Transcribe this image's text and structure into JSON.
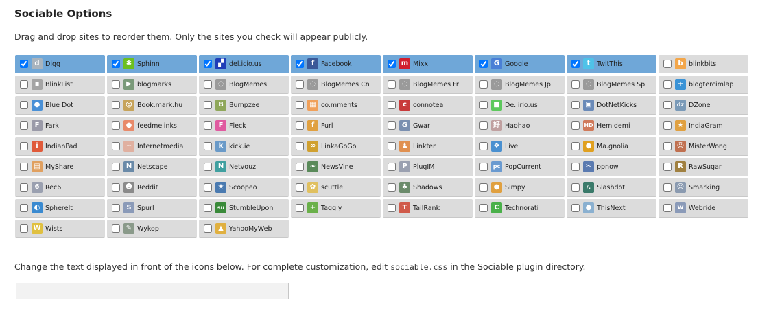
{
  "heading": "Sociable Options",
  "intro": "Drag and drop sites to reorder them. Only the sites you check will appear publicly.",
  "help": {
    "before": "Change the text displayed in front of the icons below. For complete customization, edit ",
    "code": "sociable.css",
    "after": " in the Sociable plugin directory."
  },
  "tagline": {
    "value": "",
    "placeholder": ""
  },
  "colors": {
    "checked_bg": "#6fa7d8",
    "unchecked_bg": "#dcdcdc"
  },
  "sites": [
    {
      "name": "Digg",
      "checked": true,
      "icon": "digg-icon",
      "glyph": "d",
      "color": "#a9b4be"
    },
    {
      "name": "Sphinn",
      "checked": true,
      "icon": "sphinn-icon",
      "glyph": "✱",
      "color": "#6cbf1f"
    },
    {
      "name": "del.icio.us",
      "checked": true,
      "icon": "delicious-icon",
      "glyph": "▞",
      "color": "#1f3db8"
    },
    {
      "name": "Facebook",
      "checked": true,
      "icon": "facebook-icon",
      "glyph": "f",
      "color": "#3b5998"
    },
    {
      "name": "Mixx",
      "checked": true,
      "icon": "mixx-icon",
      "glyph": "m",
      "color": "#d11f2e"
    },
    {
      "name": "Google",
      "checked": true,
      "icon": "google-icon",
      "glyph": "G",
      "color": "#4a7fd6"
    },
    {
      "name": "TwitThis",
      "checked": true,
      "icon": "twitthis-icon",
      "glyph": "t",
      "color": "#4fc2e8"
    },
    {
      "name": "blinkbits",
      "checked": false,
      "icon": "blinkbits-icon",
      "glyph": "b",
      "color": "#f3a64a"
    },
    {
      "name": "BlinkList",
      "checked": false,
      "icon": "blinklist-icon",
      "glyph": "▪",
      "color": "#a4a4a4"
    },
    {
      "name": "blogmarks",
      "checked": false,
      "icon": "blogmarks-icon",
      "glyph": "▶",
      "color": "#7a9a7a"
    },
    {
      "name": "BlogMemes",
      "checked": false,
      "icon": "blogmemes-icon",
      "glyph": "◌",
      "color": "#9a9a9a"
    },
    {
      "name": "BlogMemes Cn",
      "checked": false,
      "icon": "blogmemes-cn-icon",
      "glyph": "◌",
      "color": "#9a9a9a"
    },
    {
      "name": "BlogMemes Fr",
      "checked": false,
      "icon": "blogmemes-fr-icon",
      "glyph": "◌",
      "color": "#9a9a9a"
    },
    {
      "name": "BlogMemes Jp",
      "checked": false,
      "icon": "blogmemes-jp-icon",
      "glyph": "◌",
      "color": "#9a9a9a"
    },
    {
      "name": "BlogMemes Sp",
      "checked": false,
      "icon": "blogmemes-sp-icon",
      "glyph": "◌",
      "color": "#9a9a9a"
    },
    {
      "name": "blogtercimlap",
      "checked": false,
      "icon": "blogtercimlap-icon",
      "glyph": "+",
      "color": "#3b93d6"
    },
    {
      "name": "Blue Dot",
      "checked": false,
      "icon": "blue-dot-icon",
      "glyph": "●",
      "color": "#4a90d6"
    },
    {
      "name": "Book.mark.hu",
      "checked": false,
      "icon": "bookmark-hu-icon",
      "glyph": "@",
      "color": "#c6a35a"
    },
    {
      "name": "Bumpzee",
      "checked": false,
      "icon": "bumpzee-icon",
      "glyph": "B",
      "color": "#8fa75a"
    },
    {
      "name": "co.mments",
      "checked": false,
      "icon": "comments-icon",
      "glyph": "▦",
      "color": "#f0a05a"
    },
    {
      "name": "connotea",
      "checked": false,
      "icon": "connotea-icon",
      "glyph": "c",
      "color": "#c83a3a"
    },
    {
      "name": "De.lirio.us",
      "checked": false,
      "icon": "delirious-icon",
      "glyph": "■",
      "color": "#5dc85d"
    },
    {
      "name": "DotNetKicks",
      "checked": false,
      "icon": "dotnetkicks-icon",
      "glyph": "▣",
      "color": "#6a8ab8"
    },
    {
      "name": "DZone",
      "checked": false,
      "icon": "dzone-icon",
      "glyph": "dz",
      "color": "#7a9ab8"
    },
    {
      "name": "Fark",
      "checked": false,
      "icon": "fark-icon",
      "glyph": "F",
      "color": "#9a9aa8"
    },
    {
      "name": "feedmelinks",
      "checked": false,
      "icon": "feedmelinks-icon",
      "glyph": "●",
      "color": "#e88a6a"
    },
    {
      "name": "Fleck",
      "checked": false,
      "icon": "fleck-icon",
      "glyph": "F",
      "color": "#e05aa0"
    },
    {
      "name": "Furl",
      "checked": false,
      "icon": "furl-icon",
      "glyph": "f",
      "color": "#e0a040"
    },
    {
      "name": "Gwar",
      "checked": false,
      "icon": "gwar-icon",
      "glyph": "G",
      "color": "#7a8fb0"
    },
    {
      "name": "Haohao",
      "checked": false,
      "icon": "haohao-icon",
      "glyph": "好",
      "color": "#c0a0a0"
    },
    {
      "name": "Hemidemi",
      "checked": false,
      "icon": "hemidemi-icon",
      "glyph": "HD",
      "color": "#d07a5a"
    },
    {
      "name": "IndiaGram",
      "checked": false,
      "icon": "indiagram-icon",
      "glyph": "★",
      "color": "#e0a040"
    },
    {
      "name": "IndianPad",
      "checked": false,
      "icon": "indianpad-icon",
      "glyph": "i",
      "color": "#e05a3a"
    },
    {
      "name": "Internetmedia",
      "checked": false,
      "icon": "internetmedia-icon",
      "glyph": "~",
      "color": "#e0b0a0"
    },
    {
      "name": "kick.ie",
      "checked": false,
      "icon": "kickie-icon",
      "glyph": "k",
      "color": "#6a9ac8"
    },
    {
      "name": "LinkaGoGo",
      "checked": false,
      "icon": "linkagogo-icon",
      "glyph": "∞",
      "color": "#d0a030"
    },
    {
      "name": "Linkter",
      "checked": false,
      "icon": "linkter-icon",
      "glyph": "♟",
      "color": "#e09050"
    },
    {
      "name": "Live",
      "checked": false,
      "icon": "live-icon",
      "glyph": "❖",
      "color": "#4a90d0"
    },
    {
      "name": "Ma.gnolia",
      "checked": false,
      "icon": "magnolia-icon",
      "glyph": "●",
      "color": "#e0a020"
    },
    {
      "name": "MisterWong",
      "checked": false,
      "icon": "misterwong-icon",
      "glyph": "☺",
      "color": "#c07050"
    },
    {
      "name": "MyShare",
      "checked": false,
      "icon": "myshare-icon",
      "glyph": "▤",
      "color": "#e0a060"
    },
    {
      "name": "Netscape",
      "checked": false,
      "icon": "netscape-icon",
      "glyph": "N",
      "color": "#6a8aa8"
    },
    {
      "name": "Netvouz",
      "checked": false,
      "icon": "netvouz-icon",
      "glyph": "N",
      "color": "#40a0a0"
    },
    {
      "name": "NewsVine",
      "checked": false,
      "icon": "newsvine-icon",
      "glyph": "❧",
      "color": "#5a8a5a"
    },
    {
      "name": "PlugIM",
      "checked": false,
      "icon": "plugim-icon",
      "glyph": "P",
      "color": "#9aa0b0"
    },
    {
      "name": "PopCurrent",
      "checked": false,
      "icon": "popcurrent-icon",
      "glyph": "pc",
      "color": "#6a9ad0"
    },
    {
      "name": "ppnow",
      "checked": false,
      "icon": "ppnow-icon",
      "glyph": "✂",
      "color": "#5a7ab0"
    },
    {
      "name": "RawSugar",
      "checked": false,
      "icon": "rawsugar-icon",
      "glyph": "R",
      "color": "#a08040"
    },
    {
      "name": "Rec6",
      "checked": false,
      "icon": "rec6-icon",
      "glyph": "6",
      "color": "#9aa0b0"
    },
    {
      "name": "Reddit",
      "checked": false,
      "icon": "reddit-icon",
      "glyph": "☻",
      "color": "#8a8a8a"
    },
    {
      "name": "Scoopeo",
      "checked": false,
      "icon": "scoopeo-icon",
      "glyph": "★",
      "color": "#4a7ab0"
    },
    {
      "name": "scuttle",
      "checked": false,
      "icon": "scuttle-icon",
      "glyph": "✿",
      "color": "#e0c060"
    },
    {
      "name": "Shadows",
      "checked": false,
      "icon": "shadows-icon",
      "glyph": "♣",
      "color": "#6a8a6a"
    },
    {
      "name": "Simpy",
      "checked": false,
      "icon": "simpy-icon",
      "glyph": "●",
      "color": "#e0a040"
    },
    {
      "name": "Slashdot",
      "checked": false,
      "icon": "slashdot-icon",
      "glyph": "/.",
      "color": "#3a7a6a"
    },
    {
      "name": "Smarking",
      "checked": false,
      "icon": "smarking-icon",
      "glyph": "☺",
      "color": "#8a9ab0"
    },
    {
      "name": "SphereIt",
      "checked": false,
      "icon": "sphereit-icon",
      "glyph": "◐",
      "color": "#3a8ad0"
    },
    {
      "name": "Spurl",
      "checked": false,
      "icon": "spurl-icon",
      "glyph": "S",
      "color": "#8a9ab8"
    },
    {
      "name": "StumbleUpon",
      "checked": false,
      "icon": "stumbleupon-icon",
      "glyph": "su",
      "color": "#3a8a3a"
    },
    {
      "name": "Taggly",
      "checked": false,
      "icon": "taggly-icon",
      "glyph": "+",
      "color": "#6ab04a"
    },
    {
      "name": "TailRank",
      "checked": false,
      "icon": "tailrank-icon",
      "glyph": "T",
      "color": "#d05a4a"
    },
    {
      "name": "Technorati",
      "checked": false,
      "icon": "technorati-icon",
      "glyph": "C",
      "color": "#4ab04a"
    },
    {
      "name": "ThisNext",
      "checked": false,
      "icon": "thisnext-icon",
      "glyph": "●",
      "color": "#8ab0d0"
    },
    {
      "name": "Webride",
      "checked": false,
      "icon": "webride-icon",
      "glyph": "w",
      "color": "#8a9ab8"
    },
    {
      "name": "Wists",
      "checked": false,
      "icon": "wists-icon",
      "glyph": "W",
      "color": "#e0c040"
    },
    {
      "name": "Wykop",
      "checked": false,
      "icon": "wykop-icon",
      "glyph": "✎",
      "color": "#8a9a8a"
    },
    {
      "name": "YahooMyWeb",
      "checked": false,
      "icon": "yahoo-myweb-icon",
      "glyph": "▲",
      "color": "#e0b040"
    }
  ]
}
